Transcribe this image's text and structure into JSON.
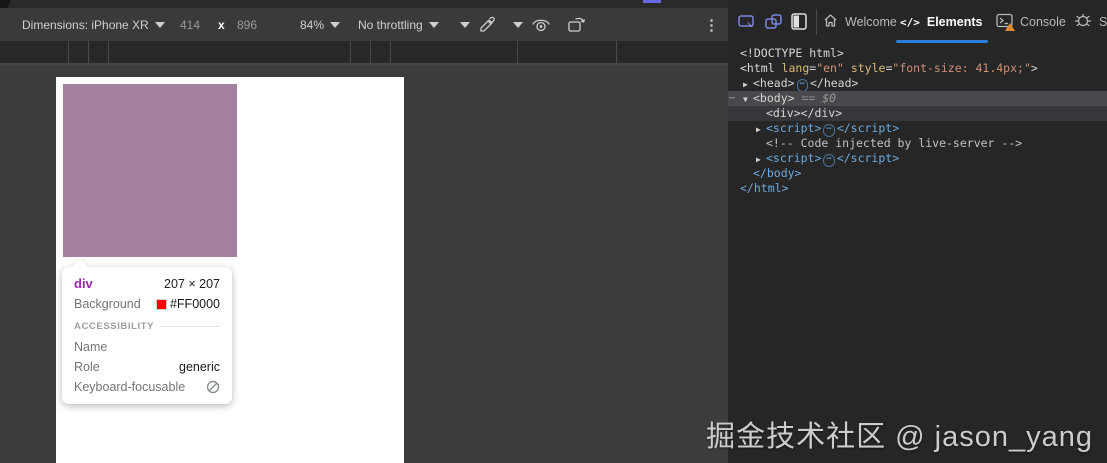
{
  "emulation_toolbar": {
    "dimensions_label": "Dimensions: iPhone XR",
    "width_value": "414",
    "separator": "x",
    "height_value": "896",
    "zoom_value": "84%",
    "throttling_value": "No throttling",
    "more_label": "⋮",
    "icons": [
      "dropdown-caret",
      "eyedropper-icon",
      "dropdown-caret",
      "eye-icon",
      "rotate-device-icon",
      "kebab-menu-icon"
    ]
  },
  "devtools": {
    "toolbar_icons": [
      "screencast-toggle-icon",
      "rotate-screen-icon",
      "dock-side-icon"
    ],
    "tabs": [
      {
        "label": "Welcome",
        "icon": "home-icon",
        "active": false
      },
      {
        "label": "Elements",
        "icon": "code-icon",
        "active": true
      },
      {
        "label": "Console",
        "icon": "console-icon",
        "active": false,
        "warning": true
      },
      {
        "label": "S",
        "icon": "bug-icon",
        "active": false
      }
    ],
    "dom_tree": [
      {
        "indent": 0,
        "exp": null,
        "state": "",
        "tokens": [
          {
            "t": "<!DOCTYPE html>",
            "c": "gray"
          }
        ]
      },
      {
        "indent": 0,
        "exp": null,
        "state": "",
        "tokens": [
          {
            "t": "<html ",
            "c": "gray"
          },
          {
            "t": "lang",
            "c": "attr"
          },
          {
            "t": "=",
            "c": "gray"
          },
          {
            "t": "\"en\"",
            "c": "val"
          },
          {
            "t": " ",
            "c": "gray"
          },
          {
            "t": "style",
            "c": "attr"
          },
          {
            "t": "=",
            "c": "gray"
          },
          {
            "t": "\"font-size: 41.4px;\"",
            "c": "val"
          },
          {
            "t": ">",
            "c": "gray"
          }
        ]
      },
      {
        "indent": 1,
        "exp": "closed",
        "state": "",
        "tokens": [
          {
            "t": "<head>",
            "c": "gray"
          },
          {
            "t": "⋯",
            "c": "pill"
          },
          {
            "t": "</head>",
            "c": "gray"
          }
        ]
      },
      {
        "indent": 1,
        "exp": "open",
        "state": "selected",
        "gutter": "⋯",
        "tokens": [
          {
            "t": "<body>",
            "c": "gray"
          },
          {
            "t": " == ",
            "c": "eq"
          },
          {
            "t": "$0",
            "c": "dollar"
          }
        ]
      },
      {
        "indent": 2,
        "exp": null,
        "state": "hover",
        "tokens": [
          {
            "t": "<div></div>",
            "c": "gray"
          }
        ]
      },
      {
        "indent": 2,
        "exp": "closed",
        "state": "",
        "tokens": [
          {
            "t": "<script>",
            "c": "blue"
          },
          {
            "t": "⋯",
            "c": "pill"
          },
          {
            "t": "</script>",
            "c": "blue"
          }
        ]
      },
      {
        "indent": 2,
        "exp": null,
        "state": "",
        "tokens": [
          {
            "t": "<!-- Code injected by live-server -->",
            "c": "comment"
          }
        ]
      },
      {
        "indent": 2,
        "exp": "closed",
        "state": "",
        "tokens": [
          {
            "t": "<script>",
            "c": "blue"
          },
          {
            "t": "⋯",
            "c": "pill"
          },
          {
            "t": "</script>",
            "c": "blue"
          }
        ]
      },
      {
        "indent": 1,
        "exp": null,
        "state": "",
        "tokens": [
          {
            "t": "</body>",
            "c": "blue"
          }
        ]
      },
      {
        "indent": 0,
        "exp": null,
        "state": "",
        "tokens": [
          {
            "t": "</html>",
            "c": "blue"
          }
        ]
      }
    ]
  },
  "inspect_tooltip": {
    "tag": "div",
    "dimensions": "207 × 207",
    "background_label": "Background",
    "background_value": "#FF0000",
    "background_swatch_color": "#FF0000",
    "section_title": "ACCESSIBILITY",
    "name_label": "Name",
    "name_value": "",
    "role_label": "Role",
    "role_value": "generic",
    "focusable_label": "Keyboard-focusable",
    "focusable_icon": "not-allowed-icon"
  },
  "highlighted_element_color": "#a3809f",
  "watermark": "掘金技术社区 @ jason_yang"
}
